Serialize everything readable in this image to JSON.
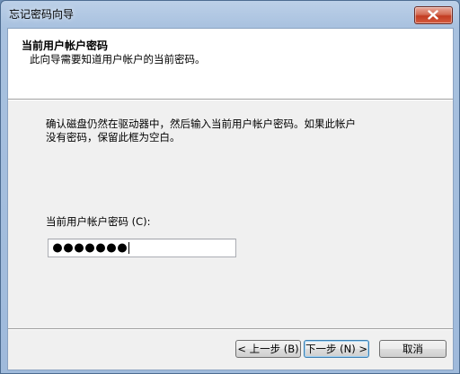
{
  "window": {
    "title": "忘记密码向导"
  },
  "header": {
    "title": "当前用户帐户密码",
    "subtitle": "此向导需要知道用户帐户的当前密码。"
  },
  "body": {
    "instruction_line1": "确认磁盘仍然在驱动器中，然后输入当前用户帐户密码。如果此帐户",
    "instruction_line2": "没有密码，保留此框为空白。",
    "password_label": "当前用户帐户密码 (C):",
    "password_masked_length": 7
  },
  "buttons": {
    "back": "< 上一步 (B)",
    "next": "下一步 (N) >",
    "cancel": "取消"
  },
  "colors": {
    "titlebar": "#a8c1df",
    "close_button": "#c23c22",
    "dialog_background": "#f0f0f0",
    "default_button_border": "#3c7fb1"
  },
  "icons": {
    "close": "close-x-icon"
  }
}
